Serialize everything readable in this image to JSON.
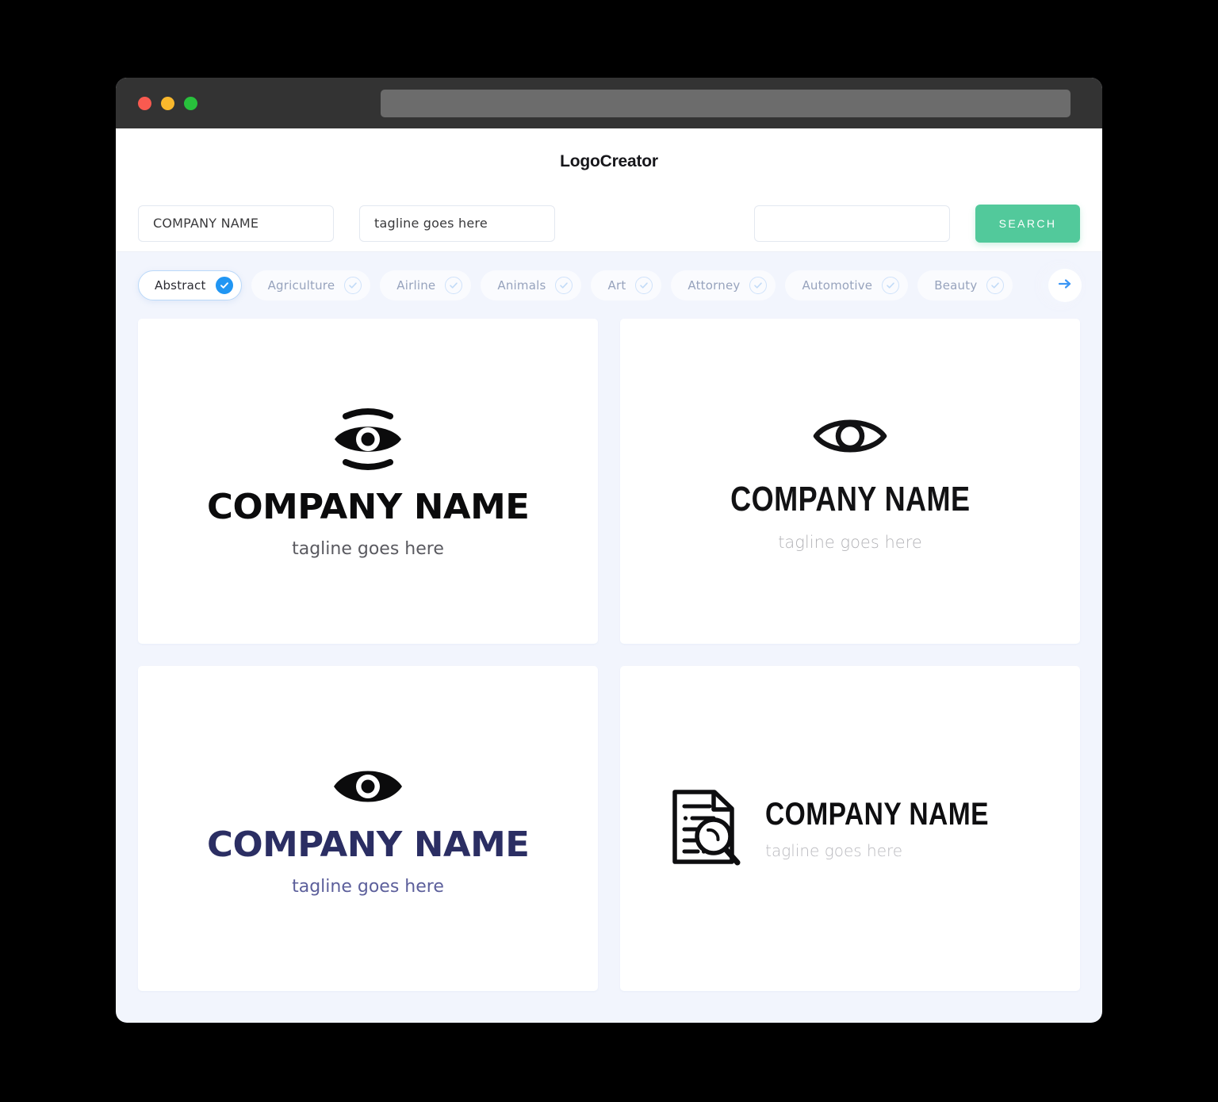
{
  "colors": {
    "accent_green": "#52C99B",
    "accent_blue": "#2196F3",
    "navy": "#2B2E63",
    "page_bg": "#F2F5FD",
    "titlebar": "#333333",
    "dot_red": "#F95A50",
    "dot_yellow": "#F9B82C",
    "dot_green": "#28C13C"
  },
  "window": {
    "dots": [
      "close",
      "minimize",
      "maximize"
    ],
    "url_value": ""
  },
  "header": {
    "title": "LogoCreator"
  },
  "search": {
    "company_name_value": "COMPANY NAME",
    "company_name_placeholder": "COMPANY NAME",
    "tagline_value": "tagline goes here",
    "tagline_placeholder": "tagline goes here",
    "third_value": "",
    "third_placeholder": "",
    "button_label": "SEARCH"
  },
  "categories": {
    "next_icon": "arrow-right-icon",
    "items": [
      {
        "label": "Abstract",
        "selected": true
      },
      {
        "label": "Agriculture",
        "selected": false
      },
      {
        "label": "Airline",
        "selected": false
      },
      {
        "label": "Animals",
        "selected": false
      },
      {
        "label": "Art",
        "selected": false
      },
      {
        "label": "Attorney",
        "selected": false
      },
      {
        "label": "Automotive",
        "selected": false
      },
      {
        "label": "Beauty",
        "selected": false
      }
    ]
  },
  "results": [
    {
      "icon": "eye-filled-with-arcs-icon",
      "name": "COMPANY NAME",
      "tagline": "tagline goes here",
      "name_color": "#0B0B0C",
      "tagline_color": "#5A5A60"
    },
    {
      "icon": "eye-outline-icon",
      "name": "COMPANY NAME",
      "tagline": "tagline goes here",
      "name_color": "#121214",
      "tagline_color": "#B4B4B8"
    },
    {
      "icon": "eye-filled-icon",
      "name": "COMPANY NAME",
      "tagline": "tagline goes here",
      "name_color": "#2B2E63",
      "tagline_color": "#5C5F9B"
    },
    {
      "icon": "document-magnifier-icon",
      "name": "COMPANY NAME",
      "tagline": "tagline goes here",
      "name_color": "#0E0E10",
      "tagline_color": "#B9B9BE"
    }
  ]
}
